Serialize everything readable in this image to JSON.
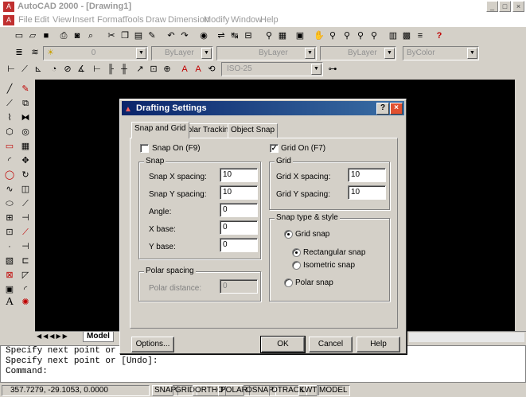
{
  "window": {
    "title": "AutoCAD 2000 - [Drawing1]",
    "min": "_",
    "max": "□",
    "close": "×"
  },
  "menu": [
    "File",
    "Edit",
    "View",
    "Insert",
    "Format",
    "Tools",
    "Draw",
    "Dimension",
    "Modify",
    "Window",
    "Help"
  ],
  "toolbar": {
    "layer_value": "0",
    "color_value": "ByLayer",
    "linetype_value": "ByLayer",
    "lineweight_value": "ByLayer",
    "plotstyle_value": "ByColor",
    "dimstyle_value": "ISO-25"
  },
  "model_tab": "Model",
  "command_lines": [
    "Specify next point or [Undo]:",
    "Specify next point or [Undo]:",
    "Command:"
  ],
  "status": {
    "coords": "357.7279, -29.1053, 0.0000",
    "buttons": [
      "SNAP",
      "GRID",
      "ORTHO",
      "POLAR",
      "OSNAP",
      "OTRACK",
      "LWT",
      "MODEL"
    ]
  },
  "dialog": {
    "title": "Drafting Settings",
    "help_btn": "?",
    "close_btn": "×",
    "tabs": [
      "Snap and Grid",
      "Polar Tracking",
      "Object Snap"
    ],
    "snap_on_label": "Snap On (F9)",
    "snap_on_checked": false,
    "grid_on_label": "Grid On (F7)",
    "grid_on_checked": true,
    "snap_group": "Snap",
    "snap_x_label": "Snap X spacing:",
    "snap_x_value": "10",
    "snap_y_label": "Snap Y spacing:",
    "snap_y_value": "10",
    "angle_label": "Angle:",
    "angle_value": "0",
    "xbase_label": "X base:",
    "xbase_value": "0",
    "ybase_label": "Y base:",
    "ybase_value": "0",
    "grid_group": "Grid",
    "grid_x_label": "Grid X spacing:",
    "grid_x_value": "10",
    "grid_y_label": "Grid Y spacing:",
    "grid_y_value": "10",
    "polar_group": "Polar spacing",
    "polar_distance_label": "Polar distance:",
    "polar_distance_value": "0",
    "snaptype_group": "Snap type & style",
    "grid_snap_label": "Grid snap",
    "rect_snap_label": "Rectangular snap",
    "iso_snap_label": "Isometric snap",
    "polar_snap_label": "Polar snap",
    "options_btn": "Options...",
    "ok_btn": "OK",
    "cancel_btn": "Cancel",
    "help_text_btn": "Help"
  }
}
